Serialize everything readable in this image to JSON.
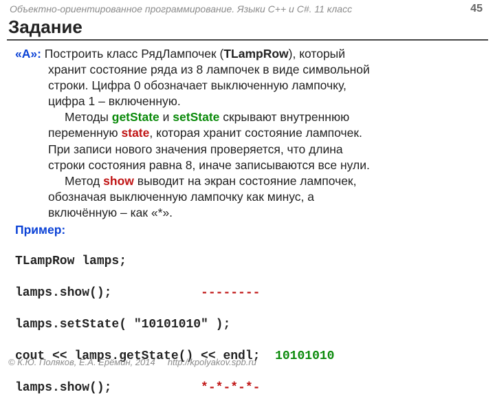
{
  "header": {
    "course": "Объектно-ориентированное программирование. Языки C++ и C#. 11 класс",
    "page": "45"
  },
  "title": "Задание",
  "task": {
    "label": "«A»:",
    "line1a": " Построить класс РядЛампочек (",
    "class_eng": "TLampRow",
    "line1b": "), который",
    "line2": "хранит состояние ряда из 8 лампочек в виде символьной",
    "line3": "строки. Цифра 0 обозначает выключенную лампочку,",
    "line4": "цифра 1 – включенную.",
    "line5a": "Методы ",
    "m_get": "getState",
    "line5b": " и ",
    "m_set": "setState",
    "line5c": " скрывают внутреннюю",
    "line6a": "переменную ",
    "m_state": "state",
    "line6b": ", которая хранит состояние лампочек.",
    "line7": "При записи нового значения проверяется, что длина",
    "line8": "строки состояния равна 8, иначе записываются все нули.",
    "line9a": "Метод ",
    "m_show": "show",
    "line9b": " выводит на экран состояние лампочек,",
    "line10": "обозначая выключенную лампочку как минус, а",
    "line11": "включённую – как «*»."
  },
  "example_label": "Пример:",
  "code": {
    "l1": "TLampRow lamps;",
    "l2a": "lamps.show();            ",
    "l2b": "--------",
    "l3": "lamps.setState( \"10101010\" );",
    "l4a": "cout << lamps.getState() << endl;  ",
    "l4b": "10101010",
    "l5a": "lamps.show();            ",
    "l5b": "*-*-*-*-"
  },
  "footer": {
    "copyright": "© К.Ю. Поляков, Е.А. Ерёмин, 2014",
    "url": "http://kpolyakov.spb.ru"
  }
}
